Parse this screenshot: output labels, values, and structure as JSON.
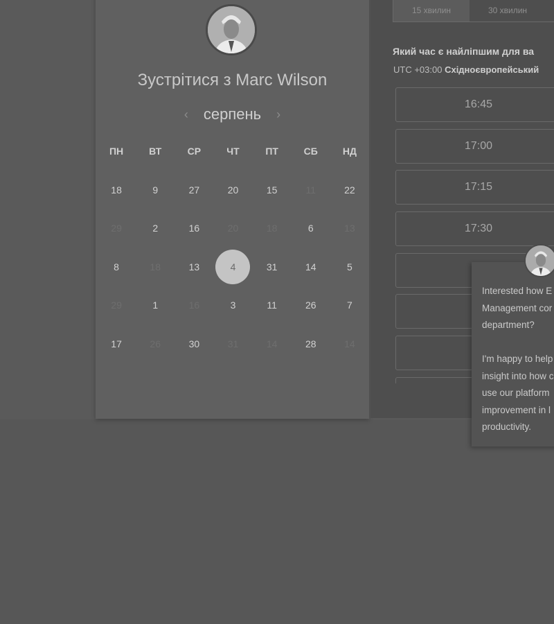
{
  "calendar": {
    "title": "Зустрітися з Marc Wilson",
    "month": "серпень",
    "prev": "‹",
    "next": "›",
    "weekdays": [
      "ПН",
      "ВТ",
      "СР",
      "ЧТ",
      "ПТ",
      "СБ",
      "НД"
    ],
    "rows": [
      [
        {
          "v": "18",
          "m": false
        },
        {
          "v": "9",
          "m": false
        },
        {
          "v": "27",
          "m": false
        },
        {
          "v": "20",
          "m": false
        },
        {
          "v": "15",
          "m": false
        },
        {
          "v": "11",
          "m": true
        },
        {
          "v": "22",
          "m": false
        }
      ],
      [
        {
          "v": "29",
          "m": true
        },
        {
          "v": "2",
          "m": false
        },
        {
          "v": "16",
          "m": false
        },
        {
          "v": "20",
          "m": true
        },
        {
          "v": "18",
          "m": true
        },
        {
          "v": "6",
          "m": false
        },
        {
          "v": "13",
          "m": true
        }
      ],
      [
        {
          "v": "8",
          "m": false
        },
        {
          "v": "18",
          "m": true
        },
        {
          "v": "13",
          "m": false
        },
        {
          "v": "4",
          "m": false,
          "sel": true
        },
        {
          "v": "31",
          "m": false
        },
        {
          "v": "14",
          "m": false
        },
        {
          "v": "5",
          "m": false
        }
      ],
      [
        {
          "v": "29",
          "m": true
        },
        {
          "v": "1",
          "m": false
        },
        {
          "v": "16",
          "m": true
        },
        {
          "v": "3",
          "m": false
        },
        {
          "v": "11",
          "m": false
        },
        {
          "v": "26",
          "m": false
        },
        {
          "v": "7",
          "m": false
        }
      ],
      [
        {
          "v": "17",
          "m": false
        },
        {
          "v": "26",
          "m": true
        },
        {
          "v": "30",
          "m": false
        },
        {
          "v": "31",
          "m": true
        },
        {
          "v": "14",
          "m": true
        },
        {
          "v": "28",
          "m": false
        },
        {
          "v": "14",
          "m": true
        }
      ]
    ]
  },
  "duration_tabs": [
    "15 хвилин",
    "30 хвилин"
  ],
  "time_panel": {
    "question": "Який час є найліпшим для ва",
    "tz_offset": "UTC +03:00",
    "tz_name": "Східноєвропейський",
    "slots": [
      "16:45",
      "17:00",
      "17:15",
      "17:30",
      "",
      "",
      "",
      ""
    ]
  },
  "chat": {
    "text": "Interested how E\nManagement cor\ndepartment?\n\nI'm happy to help\ninsight into how c\nuse our platform\nimprovement in l\nproductivity."
  }
}
